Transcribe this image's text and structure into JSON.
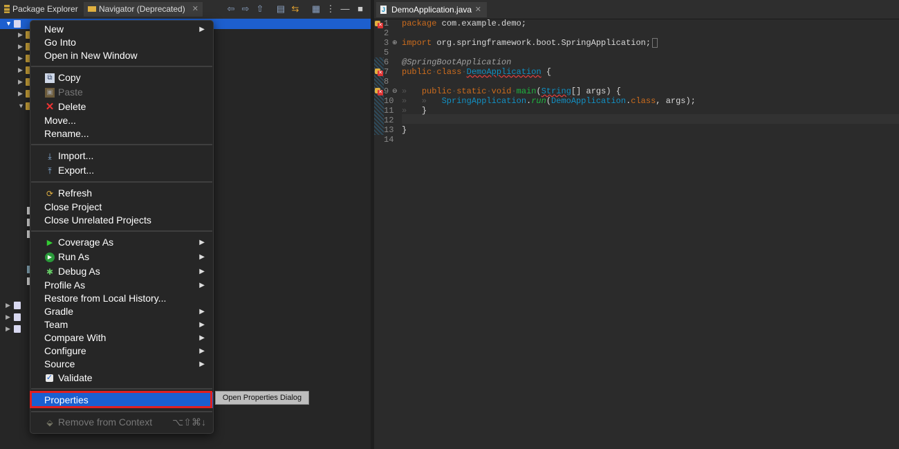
{
  "left_tabs": [
    {
      "label": "Package Explorer"
    },
    {
      "label": "Navigator (Deprecated)"
    }
  ],
  "editor": {
    "tab_label": "DemoApplication.java",
    "line_numbers": [
      "1",
      "2",
      "3",
      "5",
      "6",
      "7",
      "8",
      "9",
      "10",
      "11",
      "12",
      "13",
      "14"
    ],
    "code": {
      "l1_kw": "package",
      "l1_rest": " com.example.demo;",
      "l3_kw": "import",
      "l3_rest": " org.springframework.boot.SpringApplication;",
      "l6": "@SpringBootApplication",
      "l7_kw1": "public",
      "l7_kw2": "class",
      "l7_cls": "DemoApplication",
      "l7_rest": " {",
      "l9_kw": "public",
      "l9_kw2": "static",
      "l9_kw3": "void",
      "l9_fn": "main",
      "l9_type": "String",
      "l9_rest": "[] args) {",
      "l10_cls": "SpringApplication",
      "l10_fn": "run",
      "l10_arg": "DemoApplication",
      "l10_kw": "class",
      "l10_rest": ", args);",
      "l11": "}",
      "l13": "}"
    }
  },
  "menu": {
    "new": "New",
    "go_into": "Go Into",
    "open_new_window": "Open in New Window",
    "copy": "Copy",
    "paste": "Paste",
    "delete": "Delete",
    "move": "Move...",
    "rename": "Rename...",
    "import": "Import...",
    "export": "Export...",
    "refresh": "Refresh",
    "close_project": "Close Project",
    "close_unrelated": "Close Unrelated Projects",
    "coverage_as": "Coverage As",
    "run_as": "Run As",
    "debug_as": "Debug As",
    "profile_as": "Profile As",
    "restore_history": "Restore from Local History...",
    "gradle": "Gradle",
    "team": "Team",
    "compare_with": "Compare With",
    "configure": "Configure",
    "source": "Source",
    "validate": "Validate",
    "properties": "Properties",
    "remove_context": "Remove from Context",
    "remove_context_shortcut": "⌥⇧⌘↓"
  },
  "tooltip": "Open Properties Dialog",
  "colors": {
    "selection": "#1d5fce",
    "highlight_border": "#e02020",
    "keyword": "#cc6c1d",
    "type": "#1290c3"
  }
}
